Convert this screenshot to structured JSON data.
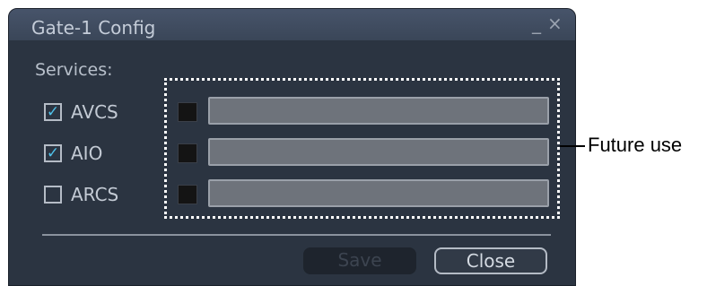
{
  "dialog": {
    "title": "Gate-1 Config",
    "minimize_glyph": "_",
    "close_glyph": "×"
  },
  "services": {
    "label": "Services:",
    "items": [
      {
        "label": "AVCS",
        "checked": true
      },
      {
        "label": "AIO",
        "checked": true
      },
      {
        "label": "ARCS",
        "checked": false
      }
    ]
  },
  "buttons": {
    "save_label": "Save",
    "close_label": "Close"
  },
  "annotation": {
    "callout": "Future use"
  },
  "colors": {
    "dialog_bg": "#2b3441",
    "checkmark": "#4fc1e9",
    "field_bg": "#6e737b"
  },
  "icons": {
    "minimize": "minimize-icon",
    "close": "close-icon",
    "checkmark": "check-icon"
  }
}
